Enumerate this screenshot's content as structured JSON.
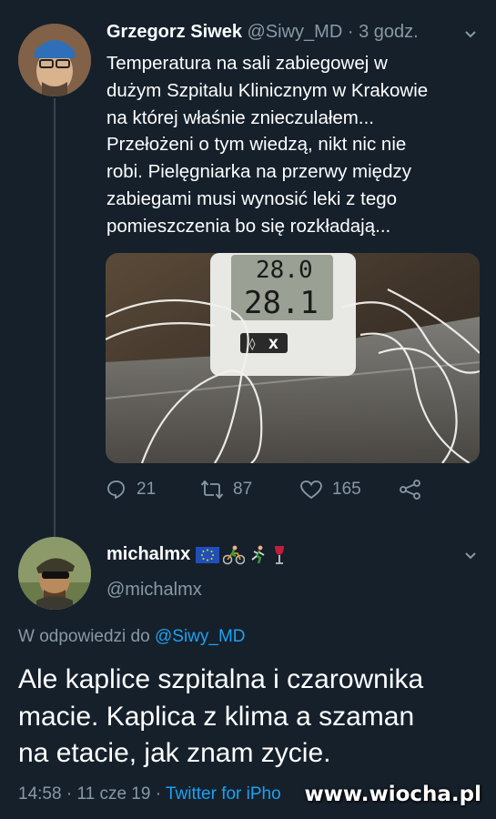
{
  "tweet1": {
    "author_name": "Grzegorz Siwek",
    "handle": "@Siwy_MD",
    "separator": "·",
    "time": "3 godz.",
    "body_lines": [
      "Temperatura na sali zabiegowej w",
      "dużym Szpitalu Klinicznym w Krakowie",
      "na której właśnie znieczulałem...",
      "Przełożeni o tym wiedzą, nikt nic nie",
      "robi. Pielęgniarka na przerwy między",
      "zabiegami musi wynosić leki z tego",
      "pomieszczenia bo się rozkładają..."
    ],
    "photo": {
      "display_top": "28.0",
      "display_bottom": "28.1",
      "button_label": "X"
    },
    "actions": {
      "replies": "21",
      "retweets": "87",
      "likes": "165"
    }
  },
  "tweet2": {
    "author_name": "michalmx",
    "handle": "@michalmx",
    "emojis": [
      "eu-flag-icon",
      "cyclist-icon",
      "runner-icon",
      "wine-glass-icon"
    ],
    "replying_to_prefix": "W odpowiedzi do",
    "replying_to_handle": "@Siwy_MD",
    "body_lines": [
      "Ale kaplice szpitalna i czarownika",
      "macie. Kaplica z klima a szaman",
      "na etacie, jak znam zycie."
    ],
    "meta": {
      "time": "14:58",
      "sep1": "·",
      "date": "11 cze 19",
      "sep2": "·",
      "client": "Twitter for iPho"
    }
  },
  "watermark": "www.wiocha.pl",
  "colors": {
    "background": "#15202b",
    "muted": "#8899a6",
    "link": "#1da1f2",
    "divider": "#38444d"
  }
}
